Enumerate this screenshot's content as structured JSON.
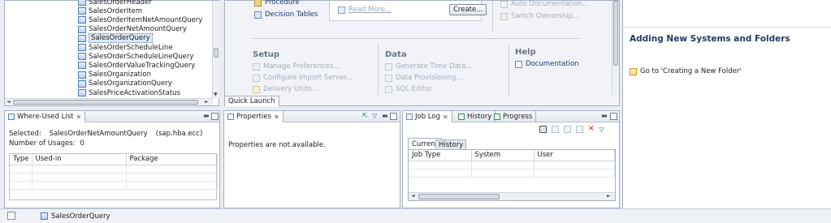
{
  "tree": {
    "items": [
      "SalesOrderHeader",
      "SalesOrderItem",
      "SalesOrderItemNetAmountQuery",
      "SalesOrderNetAmountQuery",
      "SalesOrderQuery",
      "SalesOrderScheduleLine",
      "SalesOrderScheduleLineQuery",
      "SalesOrderValueTrackingQuery",
      "SalesOrganization",
      "SalesOrganizationQuery",
      "SalesPriceActivationStatus"
    ],
    "selected_index": 4
  },
  "welcome": {
    "procedure": "Procedure",
    "decision_tables": "Decision Tables",
    "read_more": "Read More...",
    "create_button": "Create...",
    "auto_documentation": "Auto Documentation...",
    "switch_ownership": "Switch Ownership...",
    "setup": {
      "title": "Setup",
      "items": [
        "Manage Preferences...",
        "Configure Import Server...",
        "Delivery Units..."
      ]
    },
    "data": {
      "title": "Data",
      "items": [
        "Generate Time Data...",
        "Data Provisioning...",
        "SQL Editor"
      ]
    },
    "help": {
      "title": "Help",
      "items": [
        "Documentation"
      ]
    },
    "quick_launch_tab": "Quick Launch"
  },
  "right_panel": {
    "title": "Adding New Systems and Folders",
    "link": "Go to 'Creating a New Folder'"
  },
  "where_used": {
    "tab": "Where-Used List",
    "selected_label": "Selected:",
    "selected_value": "SalesOrderNetAmountQuery",
    "selected_scope": "(sap.hba.ecc)",
    "usages_label": "Number of Usages:",
    "usages_value": "0",
    "columns": [
      "Type",
      "Used-in",
      "Package"
    ]
  },
  "properties": {
    "tab": "Properties",
    "message": "Properties are not available."
  },
  "job_log": {
    "tabs": [
      "Job Log",
      "History",
      "Progress"
    ],
    "sub_tabs": [
      "Current",
      "History"
    ],
    "columns": [
      "Job Type",
      "System",
      "User"
    ]
  },
  "status_bar": {
    "selection": "SalesOrderQuery"
  }
}
